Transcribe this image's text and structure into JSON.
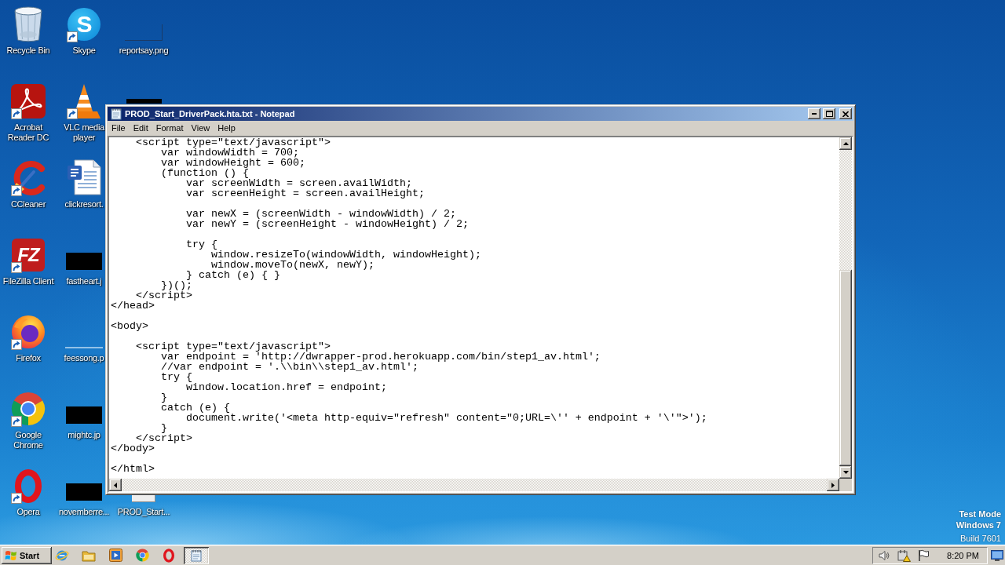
{
  "desktop": {
    "rows": [
      [
        {
          "kind": "bin",
          "label": "Recycle Bin",
          "shortcut": false
        },
        {
          "kind": "app",
          "label": "Skype",
          "logo_text": "S",
          "shortcut": true
        },
        {
          "kind": "image",
          "label": "reportsay.png",
          "shortcut": false
        }
      ],
      [
        {
          "kind": "app",
          "label": "Acrobat Reader DC",
          "shortcut": true
        },
        {
          "kind": "app",
          "label": "VLC media player",
          "shortcut": true
        },
        {
          "kind": "image",
          "shortcut": false
        }
      ],
      [
        {
          "kind": "app",
          "label": "CCleaner",
          "shortcut": true
        },
        {
          "kind": "file",
          "label": "clickresort.",
          "shortcut": false
        }
      ],
      [
        {
          "kind": "app",
          "label": "FileZilla Client",
          "logo_text": "FZ",
          "shortcut": true
        },
        {
          "kind": "image",
          "label": "fastheart.j",
          "shortcut": false
        }
      ],
      [
        {
          "kind": "app",
          "label": "Firefox",
          "shortcut": true
        },
        {
          "kind": "image",
          "label": "feessong.p",
          "shortcut": false
        }
      ],
      [
        {
          "kind": "app",
          "label": "Google Chrome",
          "shortcut": true
        },
        {
          "kind": "image",
          "label": "mightc.jp",
          "shortcut": false
        }
      ],
      [
        {
          "kind": "app",
          "label": "Opera",
          "shortcut": true
        },
        {
          "kind": "image",
          "label": "novemberre...",
          "shortcut": false
        },
        {
          "kind": "file",
          "label": "PROD_Start...",
          "shortcut": false
        }
      ]
    ]
  },
  "system_notice": {
    "lines": [
      "Test Mode",
      "Windows 7"
    ],
    "build": "Build 7601"
  },
  "window": {
    "title": "PROD_Start_DriverPack.hta.txt - Notepad",
    "active": true,
    "menu": [
      "File",
      "Edit",
      "Format",
      "View",
      "Help"
    ],
    "text_blocks": [
      [
        "    <script type=\"text/javascript\">",
        "        var windowWidth = 700;",
        "        var windowHeight = 600;",
        "        (function () {",
        "            var screenWidth = screen.availWidth;",
        "            var screenHeight = screen.availHeight;"
      ],
      [
        "            var newX = (screenWidth - windowWidth) / 2;",
        "            var newY = (screenHeight - windowHeight) / 2;"
      ],
      [
        "            try {",
        "                window.resizeTo(windowWidth, windowHeight);",
        "                window.moveTo(newX, newY);",
        "            } catch (e) { }",
        "        })();",
        "    </script>",
        "</head>"
      ],
      [
        "<body>"
      ],
      [
        "    <script type=\"text/javascript\">",
        "        var endpoint = 'http://dwrapper-prod.herokuapp.com/bin/step1_av.html';",
        "        //var endpoint = '.\\\\bin\\\\step1_av.html';",
        "        try {",
        "            window.location.href = endpoint;",
        "        }",
        "        catch (e) {",
        "            document.write('<meta http-equiv=\"refresh\" content=\"0;URL=\\'' + endpoint + '\\'\">');",
        "        }",
        "    </script>",
        "</body>"
      ],
      [
        "</html>"
      ]
    ]
  },
  "taskbar": {
    "start": "Start",
    "task_button": {
      "selected": true
    },
    "clock": "8:20 PM"
  }
}
